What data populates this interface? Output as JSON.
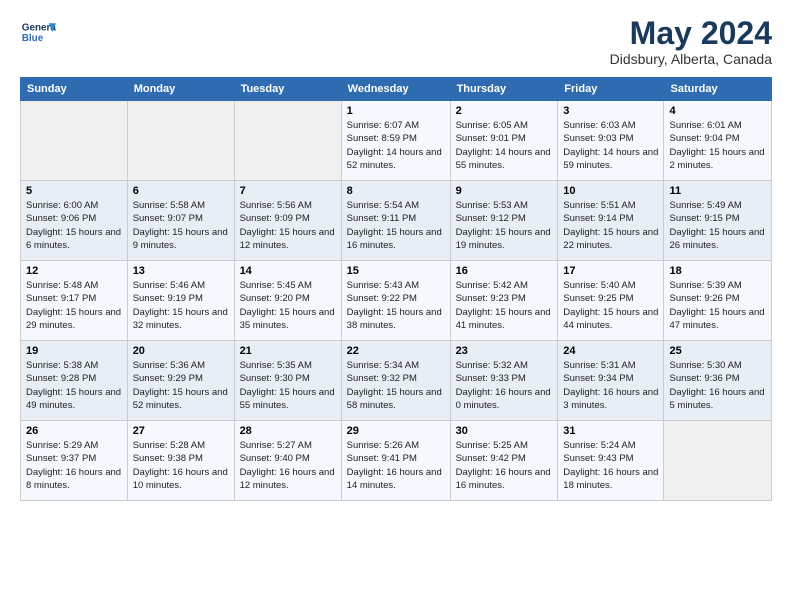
{
  "logo": {
    "line1": "General",
    "line2": "Blue"
  },
  "title": "May 2024",
  "subtitle": "Didsbury, Alberta, Canada",
  "days_of_week": [
    "Sunday",
    "Monday",
    "Tuesday",
    "Wednesday",
    "Thursday",
    "Friday",
    "Saturday"
  ],
  "weeks": [
    [
      {
        "day": "",
        "info": ""
      },
      {
        "day": "",
        "info": ""
      },
      {
        "day": "",
        "info": ""
      },
      {
        "day": "1",
        "info": "Sunrise: 6:07 AM\nSunset: 8:59 PM\nDaylight: 14 hours and 52 minutes."
      },
      {
        "day": "2",
        "info": "Sunrise: 6:05 AM\nSunset: 9:01 PM\nDaylight: 14 hours and 55 minutes."
      },
      {
        "day": "3",
        "info": "Sunrise: 6:03 AM\nSunset: 9:03 PM\nDaylight: 14 hours and 59 minutes."
      },
      {
        "day": "4",
        "info": "Sunrise: 6:01 AM\nSunset: 9:04 PM\nDaylight: 15 hours and 2 minutes."
      }
    ],
    [
      {
        "day": "5",
        "info": "Sunrise: 6:00 AM\nSunset: 9:06 PM\nDaylight: 15 hours and 6 minutes."
      },
      {
        "day": "6",
        "info": "Sunrise: 5:58 AM\nSunset: 9:07 PM\nDaylight: 15 hours and 9 minutes."
      },
      {
        "day": "7",
        "info": "Sunrise: 5:56 AM\nSunset: 9:09 PM\nDaylight: 15 hours and 12 minutes."
      },
      {
        "day": "8",
        "info": "Sunrise: 5:54 AM\nSunset: 9:11 PM\nDaylight: 15 hours and 16 minutes."
      },
      {
        "day": "9",
        "info": "Sunrise: 5:53 AM\nSunset: 9:12 PM\nDaylight: 15 hours and 19 minutes."
      },
      {
        "day": "10",
        "info": "Sunrise: 5:51 AM\nSunset: 9:14 PM\nDaylight: 15 hours and 22 minutes."
      },
      {
        "day": "11",
        "info": "Sunrise: 5:49 AM\nSunset: 9:15 PM\nDaylight: 15 hours and 26 minutes."
      }
    ],
    [
      {
        "day": "12",
        "info": "Sunrise: 5:48 AM\nSunset: 9:17 PM\nDaylight: 15 hours and 29 minutes."
      },
      {
        "day": "13",
        "info": "Sunrise: 5:46 AM\nSunset: 9:19 PM\nDaylight: 15 hours and 32 minutes."
      },
      {
        "day": "14",
        "info": "Sunrise: 5:45 AM\nSunset: 9:20 PM\nDaylight: 15 hours and 35 minutes."
      },
      {
        "day": "15",
        "info": "Sunrise: 5:43 AM\nSunset: 9:22 PM\nDaylight: 15 hours and 38 minutes."
      },
      {
        "day": "16",
        "info": "Sunrise: 5:42 AM\nSunset: 9:23 PM\nDaylight: 15 hours and 41 minutes."
      },
      {
        "day": "17",
        "info": "Sunrise: 5:40 AM\nSunset: 9:25 PM\nDaylight: 15 hours and 44 minutes."
      },
      {
        "day": "18",
        "info": "Sunrise: 5:39 AM\nSunset: 9:26 PM\nDaylight: 15 hours and 47 minutes."
      }
    ],
    [
      {
        "day": "19",
        "info": "Sunrise: 5:38 AM\nSunset: 9:28 PM\nDaylight: 15 hours and 49 minutes."
      },
      {
        "day": "20",
        "info": "Sunrise: 5:36 AM\nSunset: 9:29 PM\nDaylight: 15 hours and 52 minutes."
      },
      {
        "day": "21",
        "info": "Sunrise: 5:35 AM\nSunset: 9:30 PM\nDaylight: 15 hours and 55 minutes."
      },
      {
        "day": "22",
        "info": "Sunrise: 5:34 AM\nSunset: 9:32 PM\nDaylight: 15 hours and 58 minutes."
      },
      {
        "day": "23",
        "info": "Sunrise: 5:32 AM\nSunset: 9:33 PM\nDaylight: 16 hours and 0 minutes."
      },
      {
        "day": "24",
        "info": "Sunrise: 5:31 AM\nSunset: 9:34 PM\nDaylight: 16 hours and 3 minutes."
      },
      {
        "day": "25",
        "info": "Sunrise: 5:30 AM\nSunset: 9:36 PM\nDaylight: 16 hours and 5 minutes."
      }
    ],
    [
      {
        "day": "26",
        "info": "Sunrise: 5:29 AM\nSunset: 9:37 PM\nDaylight: 16 hours and 8 minutes."
      },
      {
        "day": "27",
        "info": "Sunrise: 5:28 AM\nSunset: 9:38 PM\nDaylight: 16 hours and 10 minutes."
      },
      {
        "day": "28",
        "info": "Sunrise: 5:27 AM\nSunset: 9:40 PM\nDaylight: 16 hours and 12 minutes."
      },
      {
        "day": "29",
        "info": "Sunrise: 5:26 AM\nSunset: 9:41 PM\nDaylight: 16 hours and 14 minutes."
      },
      {
        "day": "30",
        "info": "Sunrise: 5:25 AM\nSunset: 9:42 PM\nDaylight: 16 hours and 16 minutes."
      },
      {
        "day": "31",
        "info": "Sunrise: 5:24 AM\nSunset: 9:43 PM\nDaylight: 16 hours and 18 minutes."
      },
      {
        "day": "",
        "info": ""
      }
    ]
  ]
}
